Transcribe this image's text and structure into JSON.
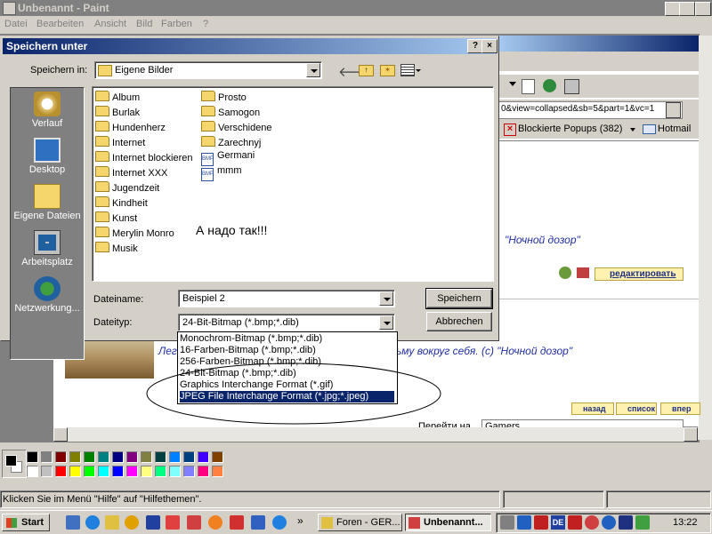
{
  "paint": {
    "title": "Unbenannt - Paint",
    "menu": [
      "Datei",
      "Bearbeiten",
      "Ansicht",
      "Bild",
      "Farben",
      "?"
    ],
    "status": "Klicken Sie im Menü \"Hilfe\" auf \"Hilfethemen\"."
  },
  "dialog": {
    "title": "Speichern unter",
    "help_btn": "?",
    "close_btn": "×",
    "save_in_label": "Speichern in:",
    "save_in_value": "Eigene Bilder",
    "places": [
      "Verlauf",
      "Desktop",
      "Eigene Dateien",
      "Arbeitsplatz",
      "Netzwerkung..."
    ],
    "files_col1": [
      "Album",
      "Burlak",
      "Hundenherz",
      "Internet",
      "Internet blockieren",
      "Internet XXX",
      "Jugendzeit",
      "Kindheit",
      "Kunst",
      "Merylin Monro",
      "Musik"
    ],
    "files_col2_folders": [
      "Prosto",
      "Samogon",
      "Verschidene",
      "Zarechnyj"
    ],
    "files_col2_bmp": [
      "Germani",
      "mmm"
    ],
    "annotation": "А надо так!!!",
    "filename_label": "Dateiname:",
    "filename_value": "Beispiel 2",
    "filetype_label": "Dateityp:",
    "filetype_value": "24-Bit-Bitmap (*.bmp;*.dib)",
    "save_button": "Speichern",
    "cancel_button": "Abbrechen",
    "filetype_options": [
      "Monochrom-Bitmap (*.bmp;*.dib)",
      "16-Farben-Bitmap (*.bmp;*.dib)",
      "256-Farben-Bitmap (*.bmp;*.dib)",
      "24-Bit-Bitmap (*.bmp;*.dib)",
      "Graphics Interchange Format (*.gif)",
      "JPEG File Interchange Format (*.jpg;*.jpeg)"
    ]
  },
  "browser": {
    "address_fragment": "0&view=collapsed&sb=5&part=1&vc=1",
    "popups": "Blockierte Popups (382)",
    "hotmail": "Hotmail",
    "quote1_tail": "\"Ночной дозор\"",
    "edit_button": "редактировать",
    "quote2_start": "Лег",
    "quote2_tail": "ьму вокруг себя. (с) \"Ночной дозор\"",
    "nav_back": "назад",
    "nav_list": "список",
    "nav_fwd": "впер",
    "goto_label": "Перейти на",
    "goto_value": "Gamers"
  },
  "taskbar": {
    "start": "Start",
    "task1": "Foren - GER...",
    "task2": "Unbenannt...",
    "clock": "13:22",
    "lang": "DE"
  },
  "colors": {
    "palette_row1": [
      "#000000",
      "#808080",
      "#800000",
      "#808000",
      "#008000",
      "#008080",
      "#000080",
      "#800080",
      "#808040",
      "#004040",
      "#0080ff",
      "#004080",
      "#4000ff",
      "#804000"
    ],
    "palette_row2": [
      "#ffffff",
      "#c0c0c0",
      "#ff0000",
      "#ffff00",
      "#00ff00",
      "#00ffff",
      "#0000ff",
      "#ff00ff",
      "#ffff80",
      "#00ff80",
      "#80ffff",
      "#8080ff",
      "#ff0080",
      "#ff8040"
    ],
    "title_active": "#0a246a"
  }
}
